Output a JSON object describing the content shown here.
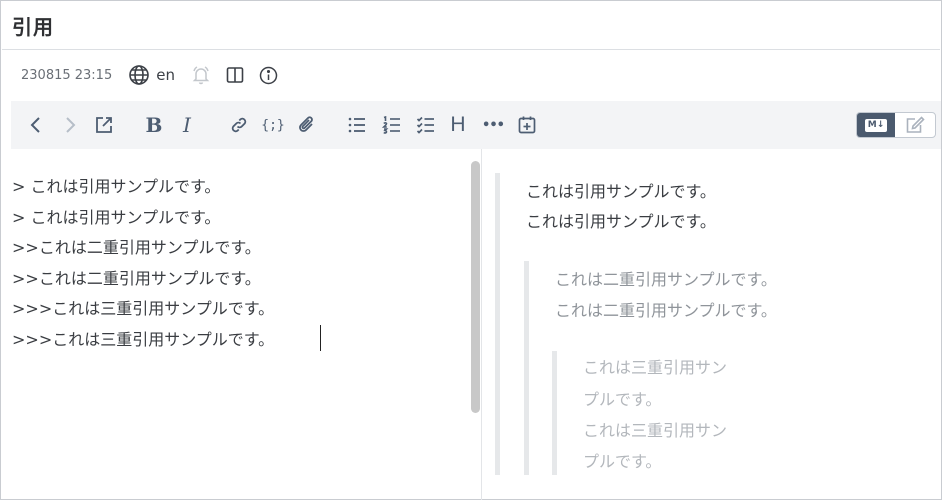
{
  "page": {
    "title": "引用"
  },
  "meta": {
    "timestamp": "230815 23:15",
    "language": "en",
    "icons": [
      "globe-icon",
      "bell-icon",
      "split-view-icon",
      "info-icon"
    ]
  },
  "toolbar": {
    "buttons": [
      "back",
      "forward",
      "open-external",
      "bold",
      "italic",
      "link",
      "code-block",
      "attachment",
      "bullet-list",
      "numbered-list",
      "checklist",
      "heading",
      "more",
      "insert-date"
    ],
    "bold_glyph": "B",
    "italic_glyph": "I",
    "code_glyph": "{;}",
    "heading_glyph": "H",
    "more_glyph": "•••",
    "mode_markdown_label": "M↓",
    "modes": [
      "markdown",
      "rich-edit"
    ],
    "active_mode": "markdown"
  },
  "editor": {
    "lines": [
      "> これは引用サンプルです。",
      "> これは引用サンプルです。",
      ">>これは二重引用サンプルです。",
      ">>これは二重引用サンプルです。",
      ">>>これは三重引用サンプルです。",
      ">>>これは三重引用サンプルです。"
    ]
  },
  "preview": {
    "level1": [
      "これは引用サンプルです。",
      "これは引用サンプルです。"
    ],
    "level2": [
      "これは二重引用サンプルです。",
      "これは二重引用サンプルです。"
    ],
    "level3": [
      "これは三重引用サン",
      "プルです。",
      "これは三重引用サン",
      "プルです。"
    ]
  },
  "colors": {
    "toolbar_bg": "#f3f4f6",
    "icon": "#4d5d72",
    "level1_text": "#3a3d42",
    "level2_text": "#8f949a",
    "level3_text": "#b3b7bc",
    "quote_bar": "#e6e8ea"
  }
}
